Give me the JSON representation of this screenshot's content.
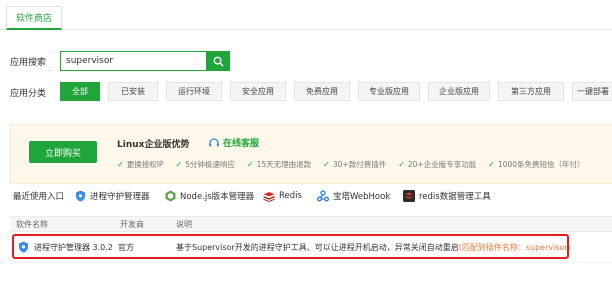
{
  "header": {
    "tab_label": "软件商店"
  },
  "search": {
    "label": "应用搜索",
    "value": "supervisor"
  },
  "categories": {
    "label": "应用分类",
    "items": [
      "全部",
      "已安装",
      "运行环境",
      "安全应用",
      "免费应用",
      "专业版应用",
      "企业版应用",
      "第三方应用",
      "一键部署"
    ]
  },
  "promo": {
    "buy_label": "立即购买",
    "title": "Linux企业版优势",
    "online_label": "在线客服",
    "features": [
      "更换授权IP",
      "5分钟极速响应",
      "15天无理由退款",
      "30+款付费插件",
      "20+企业版专享功能",
      "1000条免费短信（年付）"
    ]
  },
  "recent": {
    "label": "最近使用入口",
    "items": [
      "进程守护管理器",
      "Node.js版本管理器",
      "Redis",
      "宝塔WebHook",
      "redis数据管理工具"
    ]
  },
  "table": {
    "headers": [
      "软件名称",
      "开发商",
      "说明"
    ],
    "rows": [
      {
        "name": "进程守护管理器 3.0.2",
        "vendor": "官方",
        "description": "基于Supervisor开发的进程守护工具、可以让进程开机启动，异常关闭自动重启",
        "match_note": "(匹配到插件名称：supervisor)"
      }
    ]
  },
  "colors": {
    "accent": "#20a53a",
    "highlight": "#e02020",
    "match": "#f0783c"
  }
}
